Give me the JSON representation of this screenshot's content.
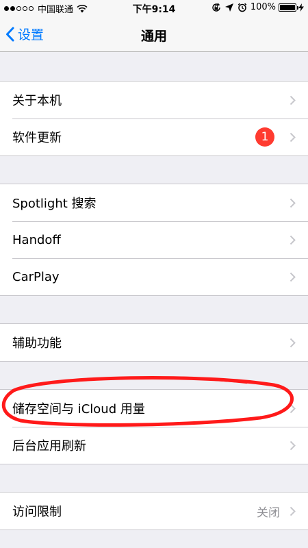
{
  "status_bar": {
    "carrier": "中国联通",
    "time": "下午9:14",
    "battery": "100%"
  },
  "nav": {
    "back_label": "设置",
    "title": "通用"
  },
  "groups": [
    {
      "rows": [
        {
          "label": "关于本机"
        },
        {
          "label": "软件更新",
          "badge": "1"
        }
      ]
    },
    {
      "rows": [
        {
          "label": "Spotlight 搜索"
        },
        {
          "label": "Handoff"
        },
        {
          "label": "CarPlay"
        }
      ]
    },
    {
      "rows": [
        {
          "label": "辅助功能"
        }
      ]
    },
    {
      "rows": [
        {
          "label": "储存空间与 iCloud 用量"
        },
        {
          "label": "后台应用刷新"
        }
      ]
    },
    {
      "rows": [
        {
          "label": "访问限制",
          "value": "关闭"
        }
      ]
    }
  ],
  "colors": {
    "accent": "#007aff",
    "badge": "#ff3b30",
    "annotation": "#ff1a1a"
  }
}
